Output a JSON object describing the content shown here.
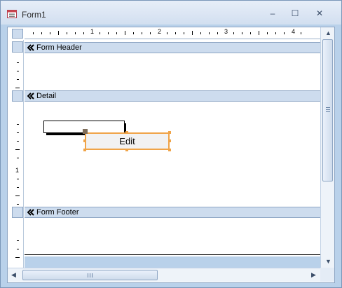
{
  "window": {
    "title": "Form1",
    "controls": {
      "minimize": "–",
      "maximize": "☐",
      "close": "✕"
    }
  },
  "ruler": {
    "horizontal_numbers": [
      "1",
      "2",
      "3",
      "4"
    ],
    "vertical_numbers": [
      "1"
    ]
  },
  "sections": {
    "form_header": "Form Header",
    "detail": "Detail",
    "form_footer": "Form Footer"
  },
  "controls": {
    "edit_button_label": "Edit"
  },
  "colors": {
    "selection_accent": "#f0a448",
    "band_header_bg": "#cddcee",
    "window_frame": "#b9d1ea"
  }
}
